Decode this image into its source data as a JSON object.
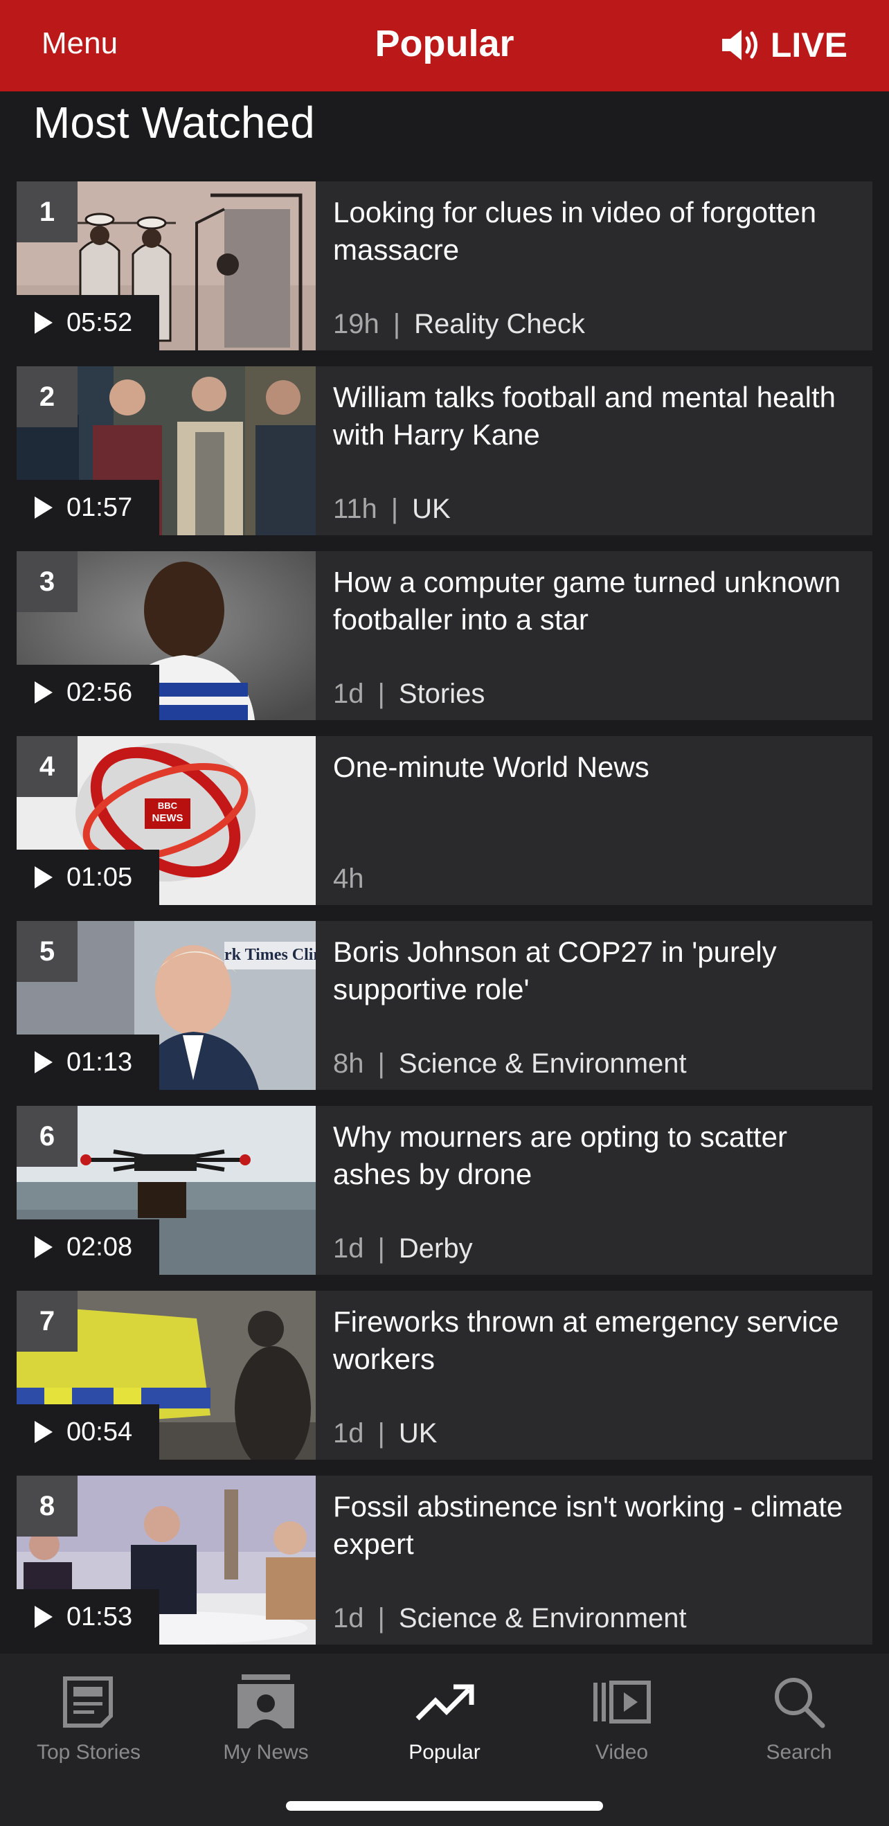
{
  "header": {
    "menu_label": "Menu",
    "title": "Popular",
    "live_label": "LIVE",
    "accent_color": "#bb1919"
  },
  "section": {
    "title": "Most Watched"
  },
  "items": [
    {
      "rank": "1",
      "duration": "05:52",
      "headline": "Looking for clues in video of forgotten massacre",
      "time": "19h",
      "separator": "|",
      "category": "Reality Check"
    },
    {
      "rank": "2",
      "duration": "01:57",
      "headline": "William talks football and mental health with Harry Kane",
      "time": "11h",
      "separator": "|",
      "category": "UK"
    },
    {
      "rank": "3",
      "duration": "02:56",
      "headline": "How a computer game turned unknown footballer into a star",
      "time": "1d",
      "separator": "|",
      "category": "Stories"
    },
    {
      "rank": "4",
      "duration": "01:05",
      "headline": "One-minute World News",
      "time": "4h",
      "separator": "",
      "category": ""
    },
    {
      "rank": "5",
      "duration": "01:13",
      "headline": "Boris Johnson at COP27 in 'purely supportive role'",
      "time": "8h",
      "separator": "|",
      "category": "Science & Environment"
    },
    {
      "rank": "6",
      "duration": "02:08",
      "headline": "Why mourners are opting to scatter ashes by drone",
      "time": "1d",
      "separator": "|",
      "category": "Derby"
    },
    {
      "rank": "7",
      "duration": "00:54",
      "headline": "Fireworks thrown at emergency service workers",
      "time": "1d",
      "separator": "|",
      "category": "UK"
    },
    {
      "rank": "8",
      "duration": "01:53",
      "headline": "Fossil abstinence isn't working - climate expert",
      "time": "1d",
      "separator": "|",
      "category": "Science & Environment"
    }
  ],
  "thumb_text": {
    "bbc_logo_top": "BBC",
    "bbc_logo_bottom": "NEWS",
    "nyt_fragment": "rk Times Clima"
  },
  "nav": {
    "items": [
      {
        "label": "Top Stories",
        "icon": "newspaper-icon"
      },
      {
        "label": "My News",
        "icon": "person-card-icon"
      },
      {
        "label": "Popular",
        "icon": "trending-icon",
        "active": true
      },
      {
        "label": "Video",
        "icon": "video-icon"
      },
      {
        "label": "Search",
        "icon": "search-icon"
      }
    ]
  }
}
